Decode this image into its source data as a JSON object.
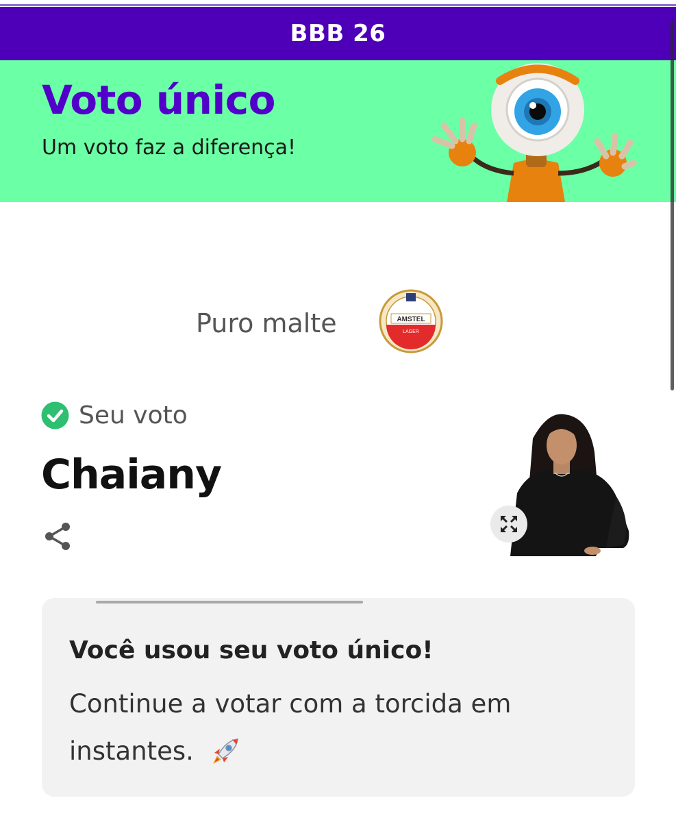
{
  "header": {
    "title": "BBB 26"
  },
  "banner": {
    "title": "Voto único",
    "subtitle": "Um voto faz a diferença!",
    "mascot_icon": "big-brother-eye-robot",
    "bg_color": "#6bffa6",
    "title_color": "#5200c9"
  },
  "sponsor": {
    "text": "Puro malte",
    "logo_icon": "amstel-lager-logo"
  },
  "vote": {
    "status_label": "Seu voto",
    "status_icon": "check-circle-icon",
    "candidate_name": "Chaiany",
    "share_icon": "share-icon",
    "expand_icon": "expand-icon"
  },
  "card": {
    "title": "Você usou seu voto único!",
    "body": "Continue a votar com a torcida em instantes.",
    "emoji_icon": "rocket-icon"
  },
  "colors": {
    "header_bg": "#4d00b8",
    "check_green": "#2fbf71"
  }
}
